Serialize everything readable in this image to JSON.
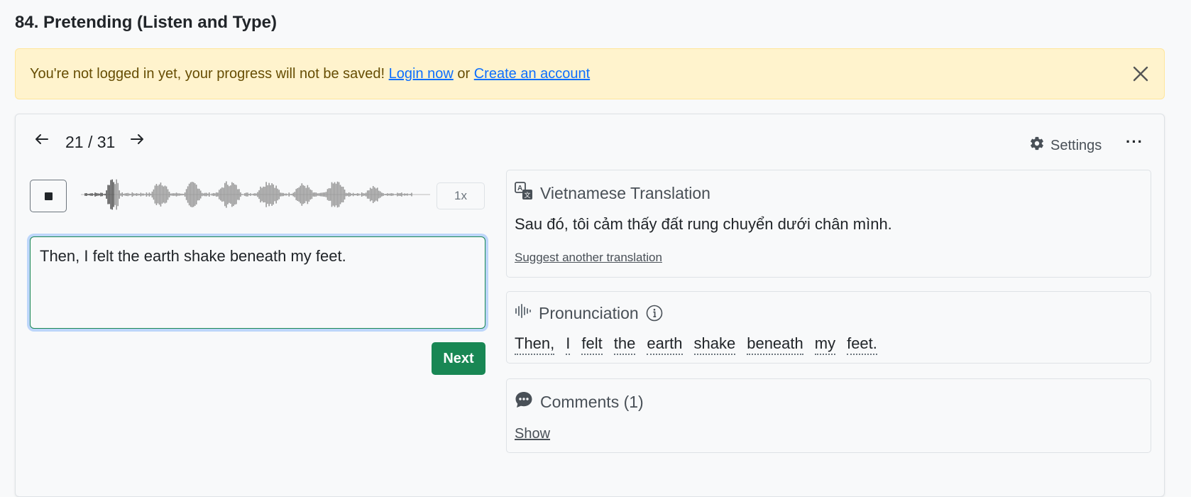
{
  "page": {
    "title": "84. Pretending (Listen and Type)"
  },
  "alert": {
    "message": "You're not logged in yet, your progress will not be saved!",
    "login_link": "Login now",
    "or_text": "or",
    "create_link": "Create an account",
    "close_icon": "close-icon"
  },
  "player": {
    "counter": "21 / 31",
    "prev_icon": "arrow-left-icon",
    "next_icon": "arrow-right-icon",
    "settings_label": "Settings",
    "more_label": "···",
    "speed": "1x",
    "stop_icon": "stop-icon",
    "playback_progress": 0.09
  },
  "answer": {
    "value": "Then, I felt the earth shake beneath my feet.",
    "next_label": "Next"
  },
  "translation": {
    "title": "Vietnamese Translation",
    "text": "Sau đó, tôi cảm thấy đất rung chuyển dưới chân mình.",
    "suggest_label": "Suggest another translation"
  },
  "pronunciation": {
    "title": "Pronunciation",
    "words": [
      "Then,",
      "I",
      "felt",
      "the",
      "earth",
      "shake",
      "beneath",
      "my",
      "feet."
    ]
  },
  "comments": {
    "title": "Comments (1)",
    "show_label": "Show"
  },
  "colors": {
    "primary_green": "#198754",
    "alert_bg": "#fff3cd",
    "link_blue": "#0d6efd",
    "waveform_played": "#555555",
    "waveform_unplayed": "#999999"
  }
}
